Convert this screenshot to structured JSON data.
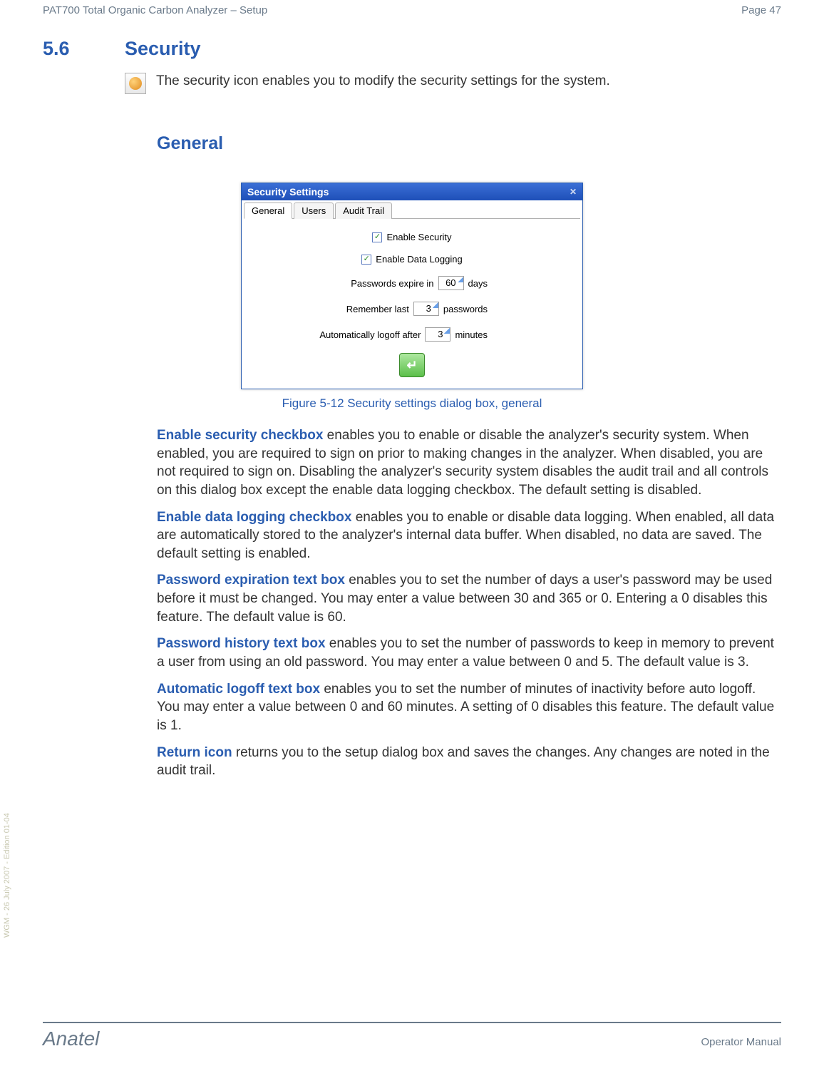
{
  "header": {
    "title": "PAT700 Total Organic Carbon Analyzer – Setup",
    "page": "Page 47"
  },
  "section": {
    "number": "5.6",
    "title": "Security",
    "intro": "The security icon enables you to modify the security settings for the system."
  },
  "subsection": {
    "title": "General"
  },
  "dialog": {
    "title": "Security Settings",
    "tabs": {
      "general": "General",
      "users": "Users",
      "audit": "Audit Trail"
    },
    "fields": {
      "enable_security": {
        "label": "Enable Security",
        "checked": "✓"
      },
      "enable_logging": {
        "label": "Enable Data Logging",
        "checked": "✓"
      },
      "pw_expire": {
        "label": "Passwords expire in",
        "value": "60",
        "unit": "days"
      },
      "remember": {
        "label": "Remember last",
        "value": "3",
        "unit": "passwords"
      },
      "auto_logoff": {
        "label": "Automatically logoff after",
        "value": "3",
        "unit": "minutes"
      }
    }
  },
  "figure": {
    "caption": "Figure 5-12 Security settings dialog box, general"
  },
  "paras": {
    "p1": {
      "lead": "Enable security checkbox",
      "rest": " enables you to enable or disable the analyzer's security system. When enabled, you are required to sign on prior to making changes in the analyzer. When disabled, you are not required to sign on. Disabling the analyzer's security system disables the audit trail and all controls on this dialog box except the enable data logging checkbox. The default setting is disabled."
    },
    "p2": {
      "lead": "Enable data logging checkbox",
      "rest": " enables you to enable or disable data logging. When enabled, all data are automatically stored to the analyzer's internal data buffer. When disabled, no data are saved. The default setting is enabled."
    },
    "p3": {
      "lead": "Password expiration text box",
      "rest": " enables you to set the number of days a user's password may be used before it must be changed. You may enter a value between 30 and 365 or 0. Entering a 0 disables this feature. The default value is 60."
    },
    "p4": {
      "lead": "Password history text box",
      "rest": " enables you to set the number of passwords to keep in memory to prevent a user from using an old password. You may enter a value between 0 and 5. The default value is 3."
    },
    "p5": {
      "lead": "Automatic logoff text box",
      "rest": " enables you to set the number of minutes of inactivity before auto logoff. You may enter a value between 0 and 60 minutes. A setting of 0 disables this feature. The default value is 1."
    },
    "p6": {
      "lead": "Return icon",
      "rest": " returns you to the setup dialog box and saves the changes. Any changes are noted in the audit trail."
    }
  },
  "side": "WGM - 26 July 2007 - Edition 01-04",
  "footer": {
    "brand": "Anatel",
    "doc": "Operator Manual"
  }
}
